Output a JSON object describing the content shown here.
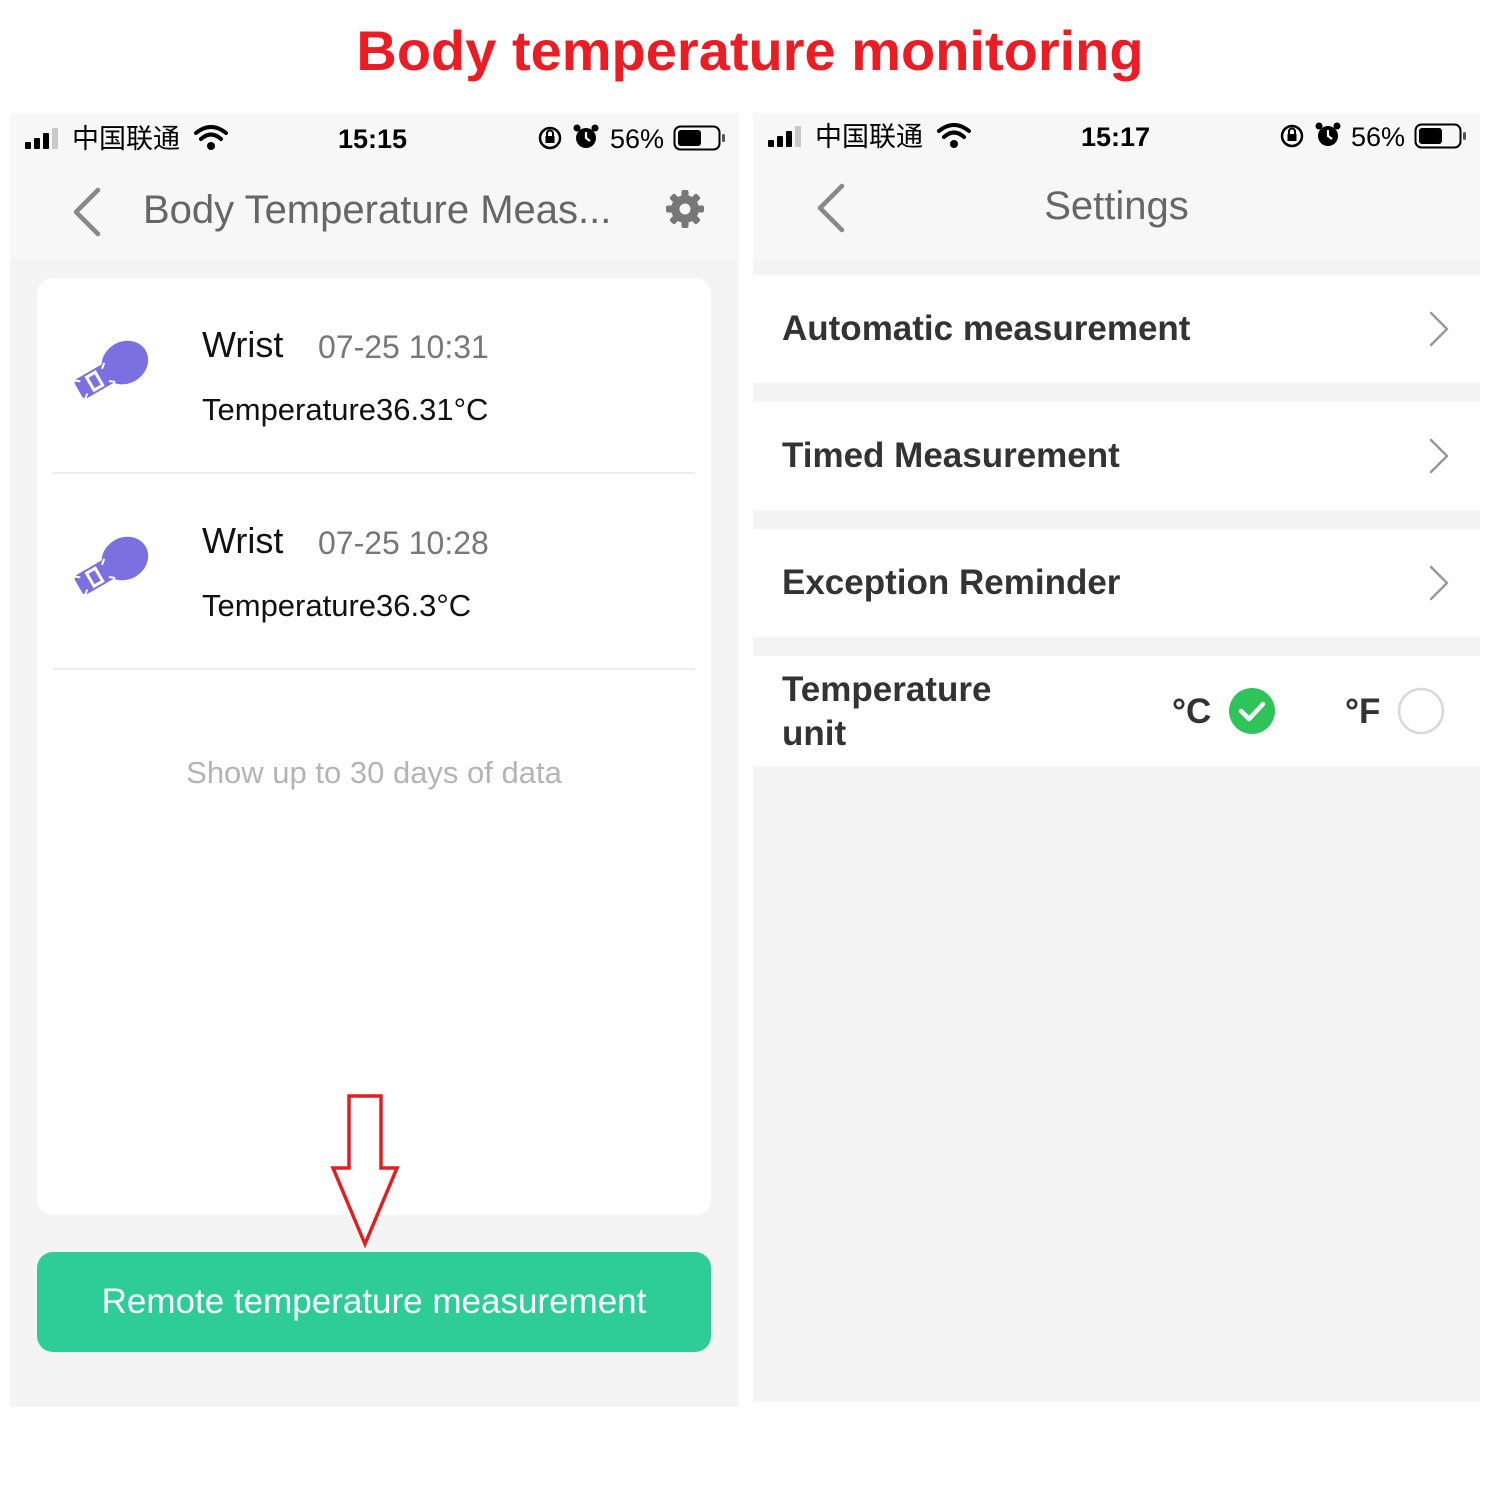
{
  "title": "Body temperature monitoring",
  "screens": [
    {
      "status": {
        "carrier": "中国联通",
        "time": "15:15",
        "battery": "56%"
      },
      "nav": {
        "title": "Body Temperature Meas..."
      },
      "records": [
        {
          "location": "Wrist",
          "datetime": "07-25 10:31",
          "temperature": "Temperature36.31°C"
        },
        {
          "location": "Wrist",
          "datetime": "07-25 10:28",
          "temperature": "Temperature36.3°C"
        }
      ],
      "note": "Show up to 30 days of data",
      "button_label": "Remote temperature measurement"
    },
    {
      "status": {
        "carrier": "中国联通",
        "time": "15:17",
        "battery": "56%"
      },
      "nav": {
        "title": "Settings"
      },
      "menu": [
        {
          "label": "Automatic measurement"
        },
        {
          "label": "Timed Measurement"
        },
        {
          "label": "Exception Reminder"
        }
      ],
      "unit": {
        "label_line1": "Temperature",
        "label_line2": "unit",
        "celsius": "°C",
        "fahrenheit": "°F",
        "selected": "°C"
      }
    }
  ],
  "colors": {
    "title_red": "#ec1c24",
    "accent_green": "#2ecc96",
    "check_green": "#2ec45a",
    "icon_purple": "#7b70e0"
  }
}
